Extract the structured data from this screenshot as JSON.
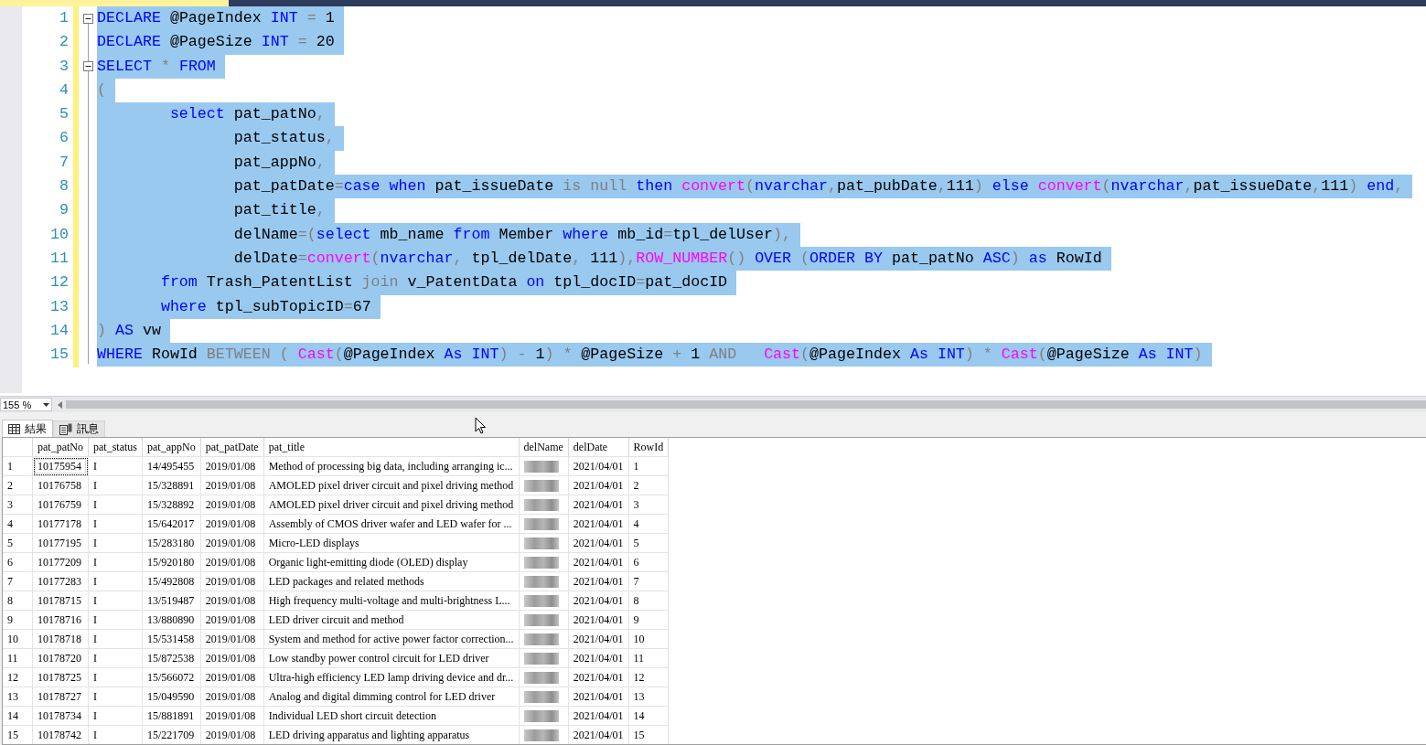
{
  "editor": {
    "lines": [
      {
        "number": "1",
        "fold": true,
        "selected": true,
        "tokens": [
          {
            "kind": "keyword",
            "text": "DECLARE"
          },
          {
            "kind": "text",
            "text": " @PageIndex "
          },
          {
            "kind": "keyword",
            "text": "INT"
          },
          {
            "kind": "operator",
            "text": " ="
          },
          {
            "kind": "text",
            "text": " 1"
          }
        ]
      },
      {
        "number": "2",
        "fold": false,
        "selected": true,
        "tokens": [
          {
            "kind": "keyword",
            "text": "DECLARE"
          },
          {
            "kind": "text",
            "text": " @PageSize "
          },
          {
            "kind": "keyword",
            "text": "INT"
          },
          {
            "kind": "operator",
            "text": " ="
          },
          {
            "kind": "text",
            "text": " 20"
          }
        ]
      },
      {
        "number": "3",
        "fold": true,
        "selected": true,
        "tokens": [
          {
            "kind": "keyword",
            "text": "SELECT"
          },
          {
            "kind": "operator",
            "text": " * "
          },
          {
            "kind": "keyword",
            "text": "FROM"
          }
        ]
      },
      {
        "number": "4",
        "fold": false,
        "selected": true,
        "tokens": [
          {
            "kind": "operator",
            "text": "("
          }
        ]
      },
      {
        "number": "5",
        "fold": false,
        "selected": true,
        "tokens": [
          {
            "kind": "keyword",
            "text": "        select"
          },
          {
            "kind": "text",
            "text": " pat_patNo"
          },
          {
            "kind": "operator",
            "text": ","
          }
        ]
      },
      {
        "number": "6",
        "fold": false,
        "selected": true,
        "tokens": [
          {
            "kind": "text",
            "text": "               pat_status"
          },
          {
            "kind": "operator",
            "text": ","
          }
        ]
      },
      {
        "number": "7",
        "fold": false,
        "selected": true,
        "tokens": [
          {
            "kind": "text",
            "text": "               pat_appNo"
          },
          {
            "kind": "operator",
            "text": ","
          }
        ]
      },
      {
        "number": "8",
        "fold": false,
        "selected": true,
        "tokens": [
          {
            "kind": "text",
            "text": "               pat_patDate"
          },
          {
            "kind": "operator",
            "text": "="
          },
          {
            "kind": "keyword",
            "text": "case when"
          },
          {
            "kind": "text",
            "text": " pat_issueDate "
          },
          {
            "kind": "operator",
            "text": "is null "
          },
          {
            "kind": "keyword",
            "text": "then"
          },
          {
            "kind": "function",
            "text": " convert"
          },
          {
            "kind": "operator",
            "text": "("
          },
          {
            "kind": "keyword",
            "text": "nvarchar"
          },
          {
            "kind": "operator",
            "text": ","
          },
          {
            "kind": "text",
            "text": "pat_pubDate"
          },
          {
            "kind": "operator",
            "text": ","
          },
          {
            "kind": "text",
            "text": "111"
          },
          {
            "kind": "operator",
            "text": ") "
          },
          {
            "kind": "keyword",
            "text": "else"
          },
          {
            "kind": "function",
            "text": " convert"
          },
          {
            "kind": "operator",
            "text": "("
          },
          {
            "kind": "keyword",
            "text": "nvarchar"
          },
          {
            "kind": "operator",
            "text": ","
          },
          {
            "kind": "text",
            "text": "pat_issueDate"
          },
          {
            "kind": "operator",
            "text": ","
          },
          {
            "kind": "text",
            "text": "111"
          },
          {
            "kind": "operator",
            "text": ") "
          },
          {
            "kind": "keyword",
            "text": "end"
          },
          {
            "kind": "operator",
            "text": ","
          }
        ]
      },
      {
        "number": "9",
        "fold": false,
        "selected": true,
        "tokens": [
          {
            "kind": "text",
            "text": "               pat_title"
          },
          {
            "kind": "operator",
            "text": ","
          }
        ]
      },
      {
        "number": "10",
        "fold": false,
        "selected": true,
        "tokens": [
          {
            "kind": "text",
            "text": "               delName"
          },
          {
            "kind": "operator",
            "text": "=("
          },
          {
            "kind": "keyword",
            "text": "select"
          },
          {
            "kind": "text",
            "text": " mb_name "
          },
          {
            "kind": "keyword",
            "text": "from"
          },
          {
            "kind": "text",
            "text": " Member "
          },
          {
            "kind": "keyword",
            "text": "where"
          },
          {
            "kind": "text",
            "text": " mb_id"
          },
          {
            "kind": "operator",
            "text": "="
          },
          {
            "kind": "text",
            "text": "tpl_delUser"
          },
          {
            "kind": "operator",
            "text": "),"
          }
        ]
      },
      {
        "number": "11",
        "fold": false,
        "selected": true,
        "tokens": [
          {
            "kind": "text",
            "text": "               delDate"
          },
          {
            "kind": "operator",
            "text": "="
          },
          {
            "kind": "function",
            "text": "convert"
          },
          {
            "kind": "operator",
            "text": "("
          },
          {
            "kind": "keyword",
            "text": "nvarchar"
          },
          {
            "kind": "operator",
            "text": ","
          },
          {
            "kind": "text",
            "text": " tpl_delDate"
          },
          {
            "kind": "operator",
            "text": ","
          },
          {
            "kind": "text",
            "text": " 111"
          },
          {
            "kind": "operator",
            "text": "),"
          },
          {
            "kind": "function",
            "text": "ROW_NUMBER"
          },
          {
            "kind": "operator",
            "text": "() "
          },
          {
            "kind": "keyword",
            "text": "OVER"
          },
          {
            "kind": "operator",
            "text": " ("
          },
          {
            "kind": "keyword",
            "text": "ORDER BY"
          },
          {
            "kind": "text",
            "text": " pat_patNo "
          },
          {
            "kind": "keyword",
            "text": "ASC"
          },
          {
            "kind": "operator",
            "text": ") "
          },
          {
            "kind": "keyword",
            "text": "as"
          },
          {
            "kind": "text",
            "text": " RowId"
          }
        ]
      },
      {
        "number": "12",
        "fold": false,
        "selected": true,
        "tokens": [
          {
            "kind": "keyword",
            "text": "       from"
          },
          {
            "kind": "text",
            "text": " Trash_PatentList "
          },
          {
            "kind": "operator",
            "text": "join"
          },
          {
            "kind": "text",
            "text": " v_PatentData "
          },
          {
            "kind": "keyword",
            "text": "on"
          },
          {
            "kind": "text",
            "text": " tpl_docID"
          },
          {
            "kind": "operator",
            "text": "="
          },
          {
            "kind": "text",
            "text": "pat_docID"
          }
        ]
      },
      {
        "number": "13",
        "fold": false,
        "selected": true,
        "tokens": [
          {
            "kind": "keyword",
            "text": "       where"
          },
          {
            "kind": "text",
            "text": " tpl_subTopicID"
          },
          {
            "kind": "operator",
            "text": "="
          },
          {
            "kind": "text",
            "text": "67"
          }
        ]
      },
      {
        "number": "14",
        "fold": false,
        "selected": true,
        "tokens": [
          {
            "kind": "operator",
            "text": ") "
          },
          {
            "kind": "keyword",
            "text": "AS"
          },
          {
            "kind": "text",
            "text": " vw"
          }
        ]
      },
      {
        "number": "15",
        "fold": false,
        "selected": true,
        "tokens": [
          {
            "kind": "keyword",
            "text": "WHERE"
          },
          {
            "kind": "text",
            "text": " RowId "
          },
          {
            "kind": "operator",
            "text": "BETWEEN ( "
          },
          {
            "kind": "function",
            "text": "Cast"
          },
          {
            "kind": "operator",
            "text": "("
          },
          {
            "kind": "text",
            "text": "@PageIndex "
          },
          {
            "kind": "keyword",
            "text": "As INT"
          },
          {
            "kind": "operator",
            "text": ") - "
          },
          {
            "kind": "text",
            "text": "1"
          },
          {
            "kind": "operator",
            "text": ") * "
          },
          {
            "kind": "text",
            "text": "@PageSize "
          },
          {
            "kind": "operator",
            "text": "+ "
          },
          {
            "kind": "text",
            "text": "1 "
          },
          {
            "kind": "operator",
            "text": "AND   "
          },
          {
            "kind": "function",
            "text": "Cast"
          },
          {
            "kind": "operator",
            "text": "("
          },
          {
            "kind": "text",
            "text": "@PageIndex "
          },
          {
            "kind": "keyword",
            "text": "As INT"
          },
          {
            "kind": "operator",
            "text": ") * "
          },
          {
            "kind": "function",
            "text": "Cast"
          },
          {
            "kind": "operator",
            "text": "("
          },
          {
            "kind": "text",
            "text": "@PageSize "
          },
          {
            "kind": "keyword",
            "text": "As INT"
          },
          {
            "kind": "operator",
            "text": ")"
          }
        ]
      }
    ]
  },
  "zoom": {
    "value": "155 %"
  },
  "result_tabs": [
    {
      "kind": "grid",
      "label": "結果",
      "selected": true
    },
    {
      "kind": "messages",
      "label": "訊息",
      "selected": false
    }
  ],
  "results": {
    "columns": [
      "pat_patNo",
      "pat_status",
      "pat_appNo",
      "pat_patDate",
      "pat_title",
      "delName",
      "delDate",
      "RowId"
    ],
    "rows": [
      {
        "number": "1",
        "focused": true,
        "cells": [
          "10175954",
          "I",
          "14/495455",
          "2019/01/08",
          "Method of processing big data, including arranging ic...",
          null,
          "2021/04/01",
          "1"
        ]
      },
      {
        "number": "2",
        "focused": false,
        "cells": [
          "10176758",
          "I",
          "15/328891",
          "2019/01/08",
          "AMOLED pixel driver circuit and pixel driving method",
          null,
          "2021/04/01",
          "2"
        ]
      },
      {
        "number": "3",
        "focused": false,
        "cells": [
          "10176759",
          "I",
          "15/328892",
          "2019/01/08",
          "AMOLED pixel driver circuit and pixel driving method",
          null,
          "2021/04/01",
          "3"
        ]
      },
      {
        "number": "4",
        "focused": false,
        "cells": [
          "10177178",
          "I",
          "15/642017",
          "2019/01/08",
          "Assembly of CMOS driver wafer and LED wafer for ...",
          null,
          "2021/04/01",
          "4"
        ]
      },
      {
        "number": "5",
        "focused": false,
        "cells": [
          "10177195",
          "I",
          "15/283180",
          "2019/01/08",
          "Micro-LED displays",
          null,
          "2021/04/01",
          "5"
        ]
      },
      {
        "number": "6",
        "focused": false,
        "cells": [
          "10177209",
          "I",
          "15/920180",
          "2019/01/08",
          "Organic light-emitting diode (OLED) display",
          null,
          "2021/04/01",
          "6"
        ]
      },
      {
        "number": "7",
        "focused": false,
        "cells": [
          "10177283",
          "I",
          "15/492808",
          "2019/01/08",
          "LED packages and related methods",
          null,
          "2021/04/01",
          "7"
        ]
      },
      {
        "number": "8",
        "focused": false,
        "cells": [
          "10178715",
          "I",
          "13/519487",
          "2019/01/08",
          "High frequency multi-voltage and multi-brightness L...",
          null,
          "2021/04/01",
          "8"
        ]
      },
      {
        "number": "9",
        "focused": false,
        "cells": [
          "10178716",
          "I",
          "13/880890",
          "2019/01/08",
          "LED driver circuit and method",
          null,
          "2021/04/01",
          "9"
        ]
      },
      {
        "number": "10",
        "focused": false,
        "cells": [
          "10178718",
          "I",
          "15/531458",
          "2019/01/08",
          "System and method for active power factor correction...",
          null,
          "2021/04/01",
          "10"
        ]
      },
      {
        "number": "11",
        "focused": false,
        "cells": [
          "10178720",
          "I",
          "15/872538",
          "2019/01/08",
          "Low standby power control circuit for LED driver",
          null,
          "2021/04/01",
          "11"
        ]
      },
      {
        "number": "12",
        "focused": false,
        "cells": [
          "10178725",
          "I",
          "15/566072",
          "2019/01/08",
          "Ultra-high efficiency LED lamp driving device and dr...",
          null,
          "2021/04/01",
          "12"
        ]
      },
      {
        "number": "13",
        "focused": false,
        "cells": [
          "10178727",
          "I",
          "15/049590",
          "2019/01/08",
          "Analog and digital dimming control for LED driver",
          null,
          "2021/04/01",
          "13"
        ]
      },
      {
        "number": "14",
        "focused": false,
        "cells": [
          "10178734",
          "I",
          "15/881891",
          "2019/01/08",
          "Individual LED short circuit detection",
          null,
          "2021/04/01",
          "14"
        ]
      },
      {
        "number": "15",
        "focused": false,
        "cells": [
          "10178742",
          "I",
          "15/221709",
          "2019/01/08",
          "LED driving apparatus and lighting apparatus",
          null,
          "2021/04/01",
          "15"
        ]
      }
    ]
  }
}
